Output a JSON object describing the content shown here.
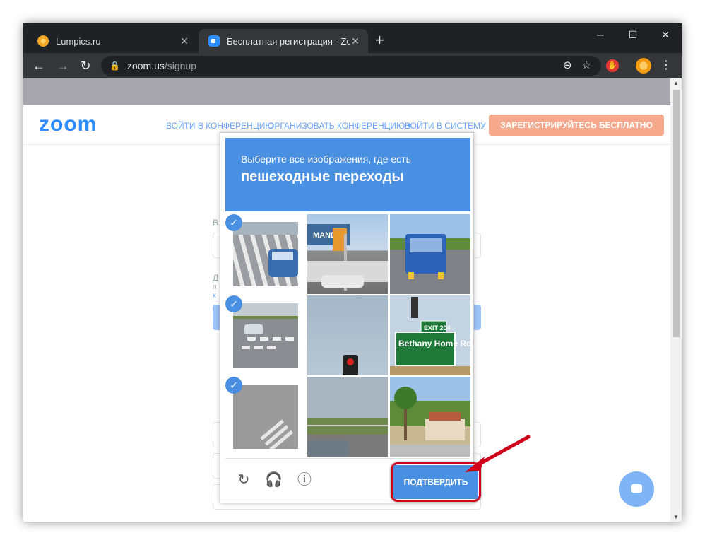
{
  "browser": {
    "tabs": [
      {
        "title": "Lumpics.ru",
        "active": false,
        "icon": "orange-favicon-icon"
      },
      {
        "title": "Бесплатная регистрация - Zoom",
        "active": true,
        "icon": "zoom-favicon-icon"
      }
    ],
    "close_glyph": "✕",
    "new_tab_glyph": "+",
    "window_controls": {
      "minimize": "─",
      "maximize": "☐",
      "close": "✕"
    },
    "nav": {
      "back": "←",
      "forward": "→",
      "reload": "↻"
    },
    "address": {
      "host": "zoom.us",
      "path": "/signup",
      "lock": "🔒"
    },
    "omni_icons": {
      "zoom_out": "⊖",
      "bookmark": "☆"
    },
    "menu_glyph": "⋮"
  },
  "zoom_page": {
    "logo": "zoom",
    "nav_links": [
      "ВОЙТИ В КОНФЕРЕНЦИЮ",
      "ОРГАНИЗОВАТЬ КОНФЕРЕНЦИЮ ▾",
      "ВОЙТИ В СИСТЕМУ"
    ],
    "signup_button": "ЗАРЕГИСТРИРУЙТЕСЬ БЕСПЛАТНО",
    "partial_labels": [
      "В",
      "Д",
      "п",
      "к"
    ]
  },
  "captcha": {
    "instruction_line1": "Выберите все изображения, где есть",
    "instruction_line2": "пешеходные переходы",
    "tiles": [
      {
        "row": 1,
        "col": 1,
        "selected": true,
        "scene": "crosswalk"
      },
      {
        "row": 1,
        "col": 2,
        "selected": false,
        "scene": "traffic-signal"
      },
      {
        "row": 1,
        "col": 3,
        "selected": false,
        "scene": "bus"
      },
      {
        "row": 2,
        "col": 1,
        "selected": true,
        "scene": "crosswalk"
      },
      {
        "row": 2,
        "col": 2,
        "selected": false,
        "scene": "red-light"
      },
      {
        "row": 2,
        "col": 3,
        "selected": false,
        "scene": "street-sign"
      },
      {
        "row": 3,
        "col": 1,
        "selected": true,
        "scene": "crosswalk"
      },
      {
        "row": 3,
        "col": 2,
        "selected": false,
        "scene": "field"
      },
      {
        "row": 3,
        "col": 3,
        "selected": false,
        "scene": "palm-trees"
      }
    ],
    "check_glyph": "✓",
    "footer_icons": {
      "reload": "↻",
      "audio": "🎧",
      "info": "ⓘ"
    },
    "verify_button": "ПОДТВЕРДИТЬ",
    "sign_text": {
      "exit": "EXIT 204",
      "street": "Bethany Home Rd"
    },
    "store_sign": "MANDEE"
  },
  "colors": {
    "captcha_blue": "#4a90e2",
    "highlight_red": "#d0021b",
    "zoom_blue": "#2d8cff",
    "signup_orange": "#f6a88d"
  }
}
